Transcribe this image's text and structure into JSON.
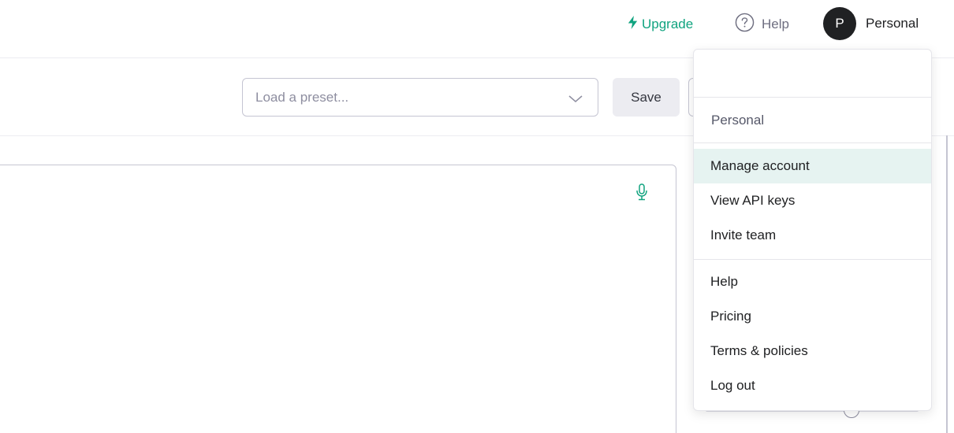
{
  "header": {
    "upgrade_label": "Upgrade",
    "help_label": "Help",
    "account": {
      "avatar_initial": "P",
      "name": "Personal"
    }
  },
  "toolbar": {
    "preset_placeholder": "Load a preset...",
    "save_label": "Save"
  },
  "account_menu": {
    "organization": "Personal",
    "items": [
      {
        "label": "Manage account",
        "active": true
      },
      {
        "label": "View API keys"
      },
      {
        "label": "Invite team"
      }
    ],
    "links": [
      {
        "label": "Help"
      },
      {
        "label": "Pricing"
      },
      {
        "label": "Terms & policies"
      },
      {
        "label": "Log out"
      }
    ]
  },
  "colors": {
    "accent": "#10a37f",
    "active_item_bg": "#e6f3f1",
    "avatar_bg": "#202123"
  },
  "icons": [
    "bolt-icon",
    "question-circle-icon",
    "chevron-down-icon",
    "microphone-icon"
  ]
}
